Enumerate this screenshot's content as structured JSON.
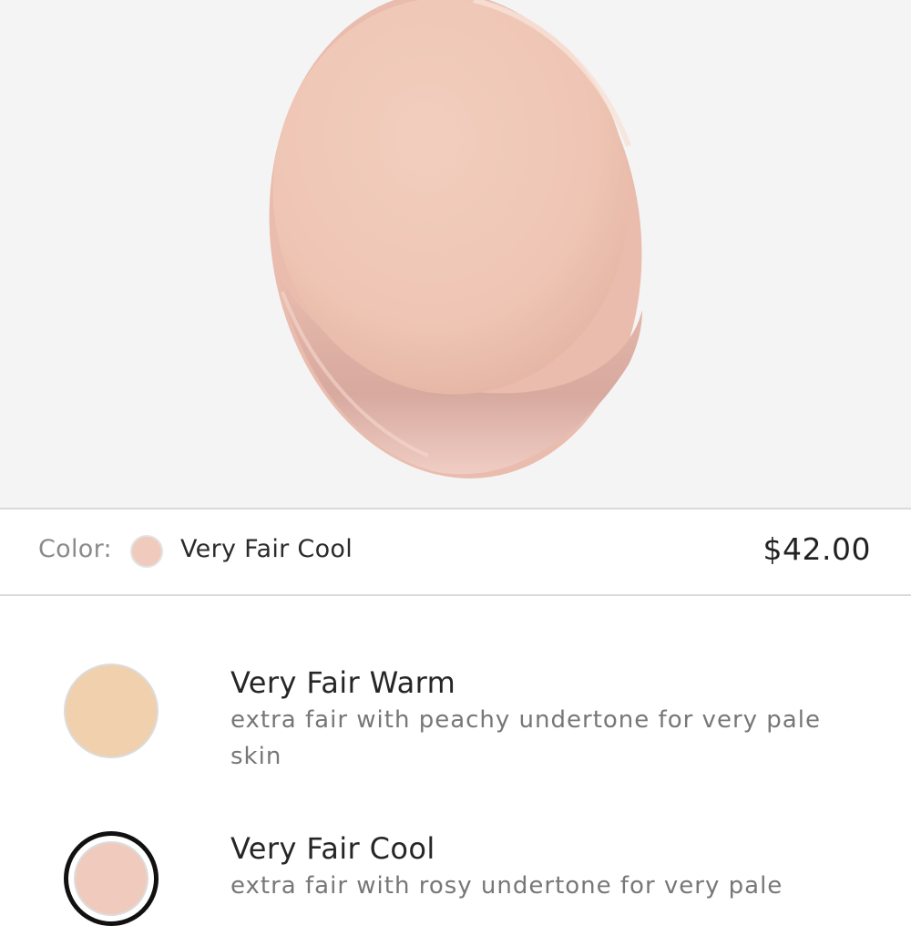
{
  "product": {
    "swatch_image": "product-swatch-image"
  },
  "selection": {
    "color_label": "Color:",
    "selected_color_name": "Very Fair Cool",
    "selected_color_hex": "#f0cbbd",
    "price": "$42.00"
  },
  "shades": [
    {
      "name": "Very Fair Warm",
      "description": "extra fair with peachy undertone for very pale skin",
      "color": "#f0d0ad",
      "selected": false
    },
    {
      "name": "Very Fair Cool",
      "description": "extra fair with rosy undertone for very pale",
      "color": "#f0cbbd",
      "selected": true
    }
  ],
  "colors": {
    "hero_background": "#f4f4f5",
    "swatch_main": "#f1cbba",
    "swatch_shadow": "#d9aea4",
    "divider": "#dadada"
  }
}
